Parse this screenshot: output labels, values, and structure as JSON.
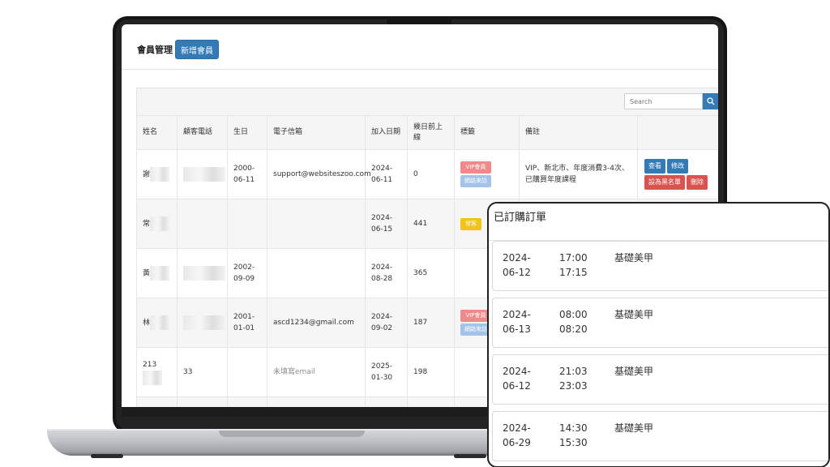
{
  "header": {
    "title": "會員管理",
    "add_button": "新增會員"
  },
  "search": {
    "placeholder": "Search"
  },
  "table": {
    "columns": [
      "姓名",
      "顧客電話",
      "生日",
      "電子信箱",
      "加入日期",
      "幾日前上線",
      "標籤",
      "備註",
      ""
    ],
    "rows": [
      {
        "name": "謝",
        "phone": "",
        "birthday": "2000-06-11",
        "email": "support@websiteszoo.com",
        "joined": "2024-06-11",
        "days": "0",
        "tags": [
          "VIP會員",
          "網路來訪"
        ],
        "note": "VIP、新北市、年度消費3-4次、已購買年度課程"
      },
      {
        "name": "常",
        "phone": "",
        "birthday": "",
        "email": "",
        "joined": "2024-06-15",
        "days": "441",
        "tags": [
          "常客"
        ],
        "note": ""
      },
      {
        "name": "黃",
        "phone": "",
        "birthday": "2002-09-09",
        "email": "",
        "joined": "2024-08-28",
        "days": "365",
        "tags": [],
        "note": ""
      },
      {
        "name": "林",
        "phone": "",
        "birthday": "2001-01-01",
        "email": "ascd1234@gmail.com",
        "joined": "2024-09-02",
        "days": "187",
        "tags": [
          "VIP會員",
          "網路來訪"
        ],
        "note": ""
      },
      {
        "name": "213",
        "phone": "33",
        "birthday": "",
        "email": "未填寫email",
        "joined": "2025-01-30",
        "days": "198",
        "tags": [],
        "note": ""
      }
    ],
    "actions": {
      "view": "查看",
      "edit": "修改",
      "blacklist": "設為黑名單",
      "delete": "刪除"
    }
  },
  "orders": {
    "title": "已訂購訂單",
    "items": [
      {
        "date": "2024-06-12",
        "start": "17:00",
        "end": "17:15",
        "service": "基礎美甲"
      },
      {
        "date": "2024-06-13",
        "start": "08:00",
        "end": "08:20",
        "service": "基礎美甲"
      },
      {
        "date": "2024-06-12",
        "start": "21:03",
        "end": "23:03",
        "service": "基礎美甲"
      },
      {
        "date": "2024-06-29",
        "start": "14:30",
        "end": "15:30",
        "service": "基礎美甲"
      }
    ]
  },
  "colors": {
    "primary": "#337ab7",
    "danger": "#d9534f",
    "vip_tag": "#f08a8a",
    "online_tag": "#a4c3e8",
    "regular_tag": "#f0c419"
  }
}
